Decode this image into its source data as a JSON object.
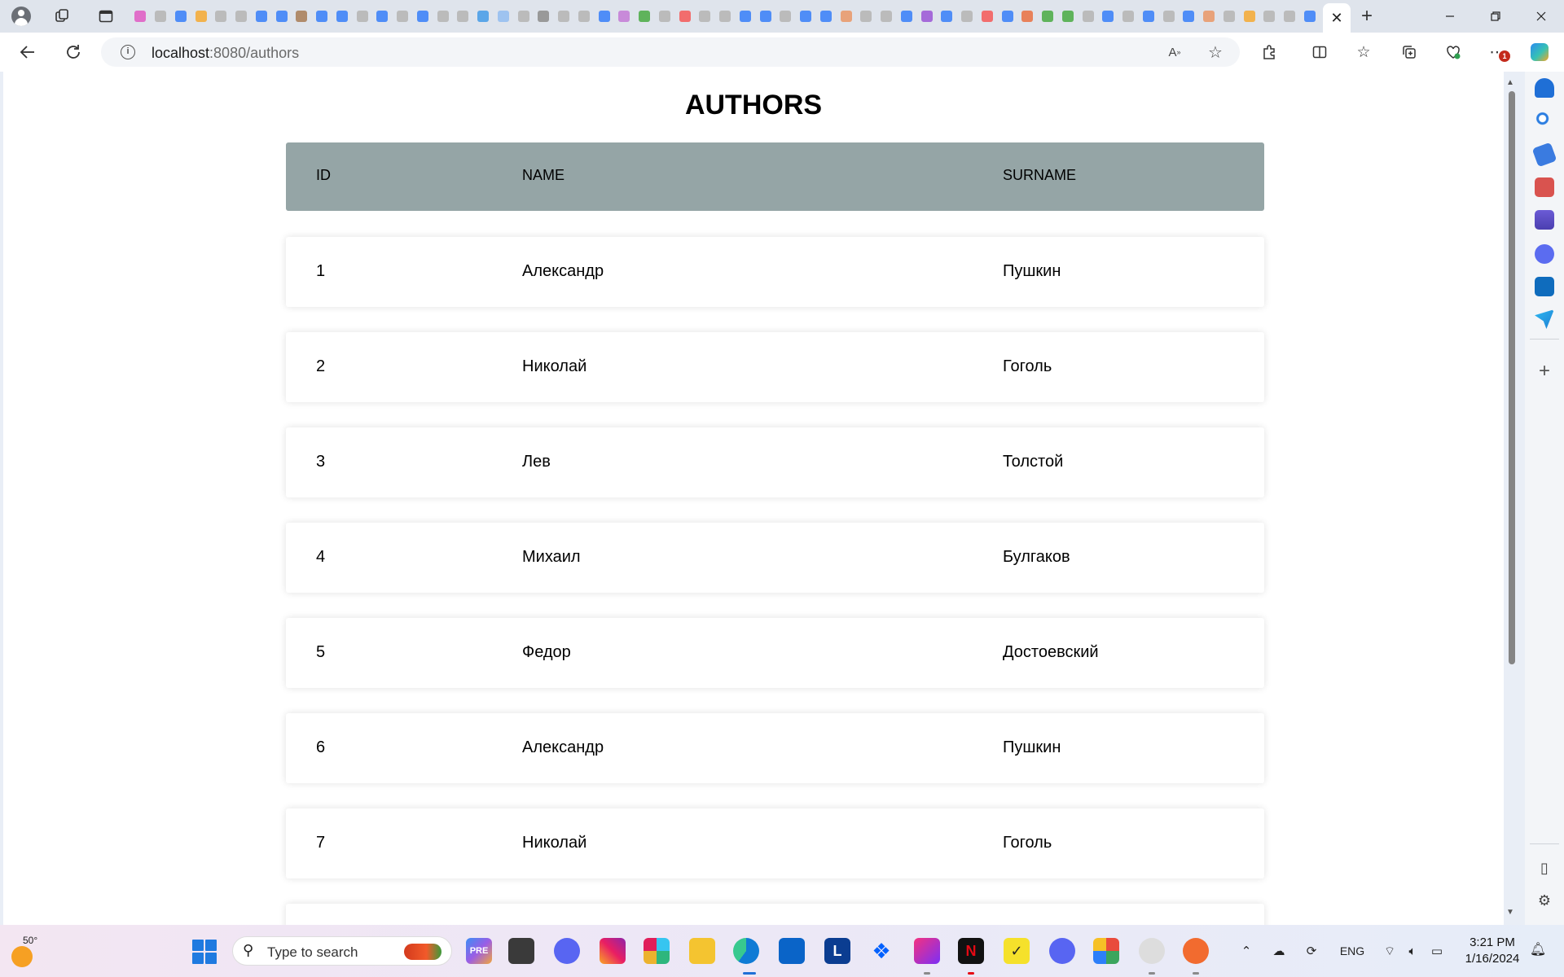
{
  "browser": {
    "tab_favicon_colors": [
      "#e06ec9",
      "#bbbbbb",
      "#4f8df7",
      "#f2b24d",
      "#bbbbbb",
      "#bbbbbb",
      "#4f8df7",
      "#4f8df7",
      "#b08b6b",
      "#4f8df7",
      "#4f8df7",
      "#bbbbbb",
      "#4f8df7",
      "#bbbbbb",
      "#4f8df7",
      "#bbbbbb",
      "#bbbbbb",
      "#5ba6e8",
      "#9ec3f0",
      "#bbbbbb",
      "#999999",
      "#bbbbbb",
      "#bbbbbb",
      "#4f8df7",
      "#c88ad9",
      "#5fb35b",
      "#bbbbbb",
      "#f26d6d",
      "#bbbbbb",
      "#bbbbbb",
      "#4f8df7",
      "#4f8df7",
      "#bbbbbb",
      "#4f8df7",
      "#4f8df7",
      "#e8a27a",
      "#bbbbbb",
      "#bbbbbb",
      "#4f8df7",
      "#a56ad9",
      "#4f8df7",
      "#bbbbbb",
      "#f26d6d",
      "#4f8df7",
      "#e8815a",
      "#5fb35b",
      "#5fb35b",
      "#bbbbbb",
      "#4f8df7",
      "#bbbbbb",
      "#4f8df7",
      "#bbbbbb",
      "#4f8df7",
      "#e8a27a",
      "#bbbbbb",
      "#f2b24d",
      "#bbbbbb",
      "#bbbbbb",
      "#4f8df7"
    ],
    "active_tab_close": "✕",
    "new_tab": "+",
    "url_host": "localhost",
    "url_path": ":8080/authors",
    "more_badge": "1",
    "accent_color": "#1f7ae0"
  },
  "page": {
    "title": "AUTHORS",
    "header_color": "#95a5a6",
    "columns": {
      "id": "ID",
      "name": "NAME",
      "surname": "SURNAME"
    },
    "rows": [
      {
        "id": "1",
        "name": "Александр",
        "surname": "Пушкин"
      },
      {
        "id": "2",
        "name": "Николай",
        "surname": "Гоголь"
      },
      {
        "id": "3",
        "name": "Лев",
        "surname": "Толстой"
      },
      {
        "id": "4",
        "name": "Михаил",
        "surname": "Булгаков"
      },
      {
        "id": "5",
        "name": "Федор",
        "surname": "Достоевский"
      },
      {
        "id": "6",
        "name": "Александр",
        "surname": "Пушкин"
      },
      {
        "id": "7",
        "name": "Николай",
        "surname": "Гоголь"
      },
      {
        "id": "",
        "name": "",
        "surname": ""
      }
    ]
  },
  "taskbar": {
    "weather_temp": "50°",
    "search_placeholder": "Type to search",
    "language": "ENG",
    "time": "3:21 PM",
    "date": "1/16/2024"
  }
}
